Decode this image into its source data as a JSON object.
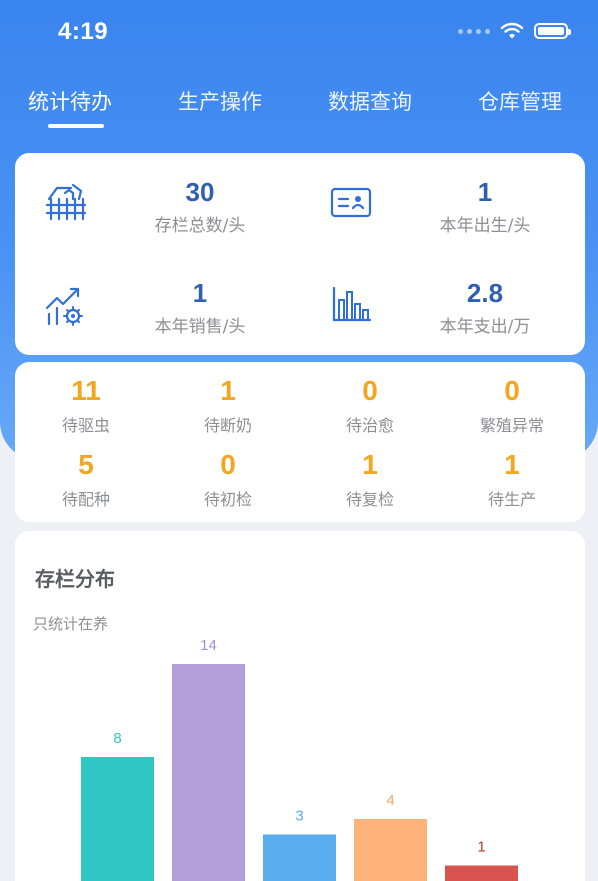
{
  "status_bar": {
    "time": "4:19"
  },
  "tabs": [
    {
      "label": "统计待办",
      "active": true
    },
    {
      "label": "生产操作",
      "active": false
    },
    {
      "label": "数据查询",
      "active": false
    },
    {
      "label": "仓库管理",
      "active": false
    }
  ],
  "stats": [
    {
      "value": "30",
      "label": "存栏总数/头",
      "icon": "barn-fence-icon"
    },
    {
      "value": "1",
      "label": "本年出生/头",
      "icon": "id-card-icon"
    },
    {
      "value": "1",
      "label": "本年销售/头",
      "icon": "growth-gear-icon"
    },
    {
      "value": "2.8",
      "label": "本年支出/万",
      "icon": "bar-chart-icon"
    }
  ],
  "todos": [
    {
      "value": "11",
      "label": "待驱虫"
    },
    {
      "value": "1",
      "label": "待断奶"
    },
    {
      "value": "0",
      "label": "待治愈"
    },
    {
      "value": "0",
      "label": "繁殖异常"
    },
    {
      "value": "5",
      "label": "待配种"
    },
    {
      "value": "0",
      "label": "待初检"
    },
    {
      "value": "1",
      "label": "待复检"
    },
    {
      "value": "1",
      "label": "待生产"
    }
  ],
  "colors": {
    "primary": "#3a84ee",
    "stat_value": "#2e5fb3",
    "todo_value": "#f3a61f",
    "label_gray": "#8e8e96"
  },
  "chart": {
    "title": "存栏分布",
    "subtitle": "只统计在养"
  },
  "chart_data": {
    "type": "bar",
    "values": [
      8,
      14,
      3,
      4,
      1
    ],
    "colors": [
      "#30c6c4",
      "#b39ddb",
      "#5aaef0",
      "#ffb37a",
      "#d9534f"
    ],
    "label_colors": [
      "#30c6c4",
      "#a58fd0",
      "#5aaef0",
      "#f3a66a",
      "#c0392b"
    ],
    "ylim": [
      0,
      14
    ]
  }
}
